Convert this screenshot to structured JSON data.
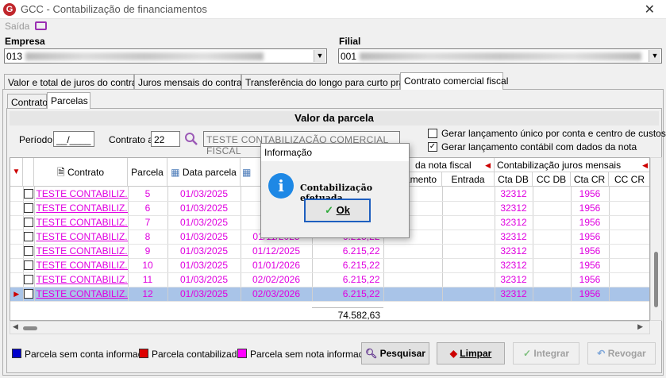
{
  "window": {
    "title": "GCC - Contabilização de financiamentos",
    "close": "✕",
    "logo": "G"
  },
  "menu": {
    "exit_label": "Saída"
  },
  "empresa": {
    "label": "Empresa",
    "value": "013"
  },
  "filial": {
    "label": "Filial",
    "value": "001"
  },
  "tabs": [
    "Valor e total de juros do contrato",
    "Juros mensais do contrato",
    "Transferência do longo para curto prazo",
    "Contrato comercial fiscal"
  ],
  "subtabs": [
    "Contrato",
    "Parcelas"
  ],
  "section_title": "Valor da parcela",
  "filters": {
    "periodo_label": "Período",
    "periodo_value": "__/____",
    "contrato_label": "Contrato a",
    "contrato_value": "22",
    "contrato_desc": "TESTE CONTABILIZAÇÃO COMERCIAL FISCAL",
    "opt1_label": "Gerar lançamento único por conta e centro de custos",
    "opt1_checked": false,
    "opt2_label": "Gerar lançamento contábil com dados da nota",
    "opt2_checked": true
  },
  "grid": {
    "group_nota": "da nota fiscal",
    "group_juros": "Contabilização juros mensais",
    "columns": [
      "Contrato",
      "Parcela",
      "Data parcela",
      "",
      "amento",
      "Entrada",
      "Cta DB",
      "CC DB",
      "Cta CR",
      "CC CR"
    ],
    "rows": [
      {
        "contrato": "TESTE CONTABILIZ...",
        "parcela": "5",
        "data": "01/03/2025",
        "venc": "01",
        "valor": "",
        "cta_db": "32312",
        "cta_cr": "1956"
      },
      {
        "contrato": "TESTE CONTABILIZ...",
        "parcela": "6",
        "data": "01/03/2025",
        "venc": "01",
        "valor": "",
        "cta_db": "32312",
        "cta_cr": "1956"
      },
      {
        "contrato": "TESTE CONTABILIZ...",
        "parcela": "7",
        "data": "01/03/2025",
        "venc": "01",
        "valor": "",
        "cta_db": "32312",
        "cta_cr": "1956"
      },
      {
        "contrato": "TESTE CONTABILIZ...",
        "parcela": "8",
        "data": "01/03/2025",
        "venc": "01/11/2025",
        "valor": "6.215,22",
        "cta_db": "32312",
        "cta_cr": "1956"
      },
      {
        "contrato": "TESTE CONTABILIZ...",
        "parcela": "9",
        "data": "01/03/2025",
        "venc": "01/12/2025",
        "valor": "6.215,22",
        "cta_db": "32312",
        "cta_cr": "1956"
      },
      {
        "contrato": "TESTE CONTABILIZ...",
        "parcela": "10",
        "data": "01/03/2025",
        "venc": "01/01/2026",
        "valor": "6.215,22",
        "cta_db": "32312",
        "cta_cr": "1956"
      },
      {
        "contrato": "TESTE CONTABILIZ...",
        "parcela": "11",
        "data": "01/03/2025",
        "venc": "02/02/2026",
        "valor": "6.215,22",
        "cta_db": "32312",
        "cta_cr": "1956"
      },
      {
        "contrato": "TESTE CONTABILIZ...",
        "parcela": "12",
        "data": "01/03/2025",
        "venc": "02/03/2026",
        "valor": "6.215,22",
        "cta_db": "32312",
        "cta_cr": "1956"
      }
    ],
    "total": "74.582,63"
  },
  "legend": [
    {
      "label": "Parcela sem conta informada",
      "color": "#0000cc"
    },
    {
      "label": "Parcela contabilizada",
      "color": "#dd0000"
    },
    {
      "label": "Parcela sem nota informada",
      "color": "#ff00ff"
    }
  ],
  "buttons": {
    "pesquisar": "Pesquisar",
    "limpar": "Limpar",
    "integrar": "Integrar",
    "revogar": "Revogar"
  },
  "dialog": {
    "title": "Informação",
    "message": "Contabilização efetuada.",
    "ok": "Ok",
    "info_glyph": "i"
  }
}
